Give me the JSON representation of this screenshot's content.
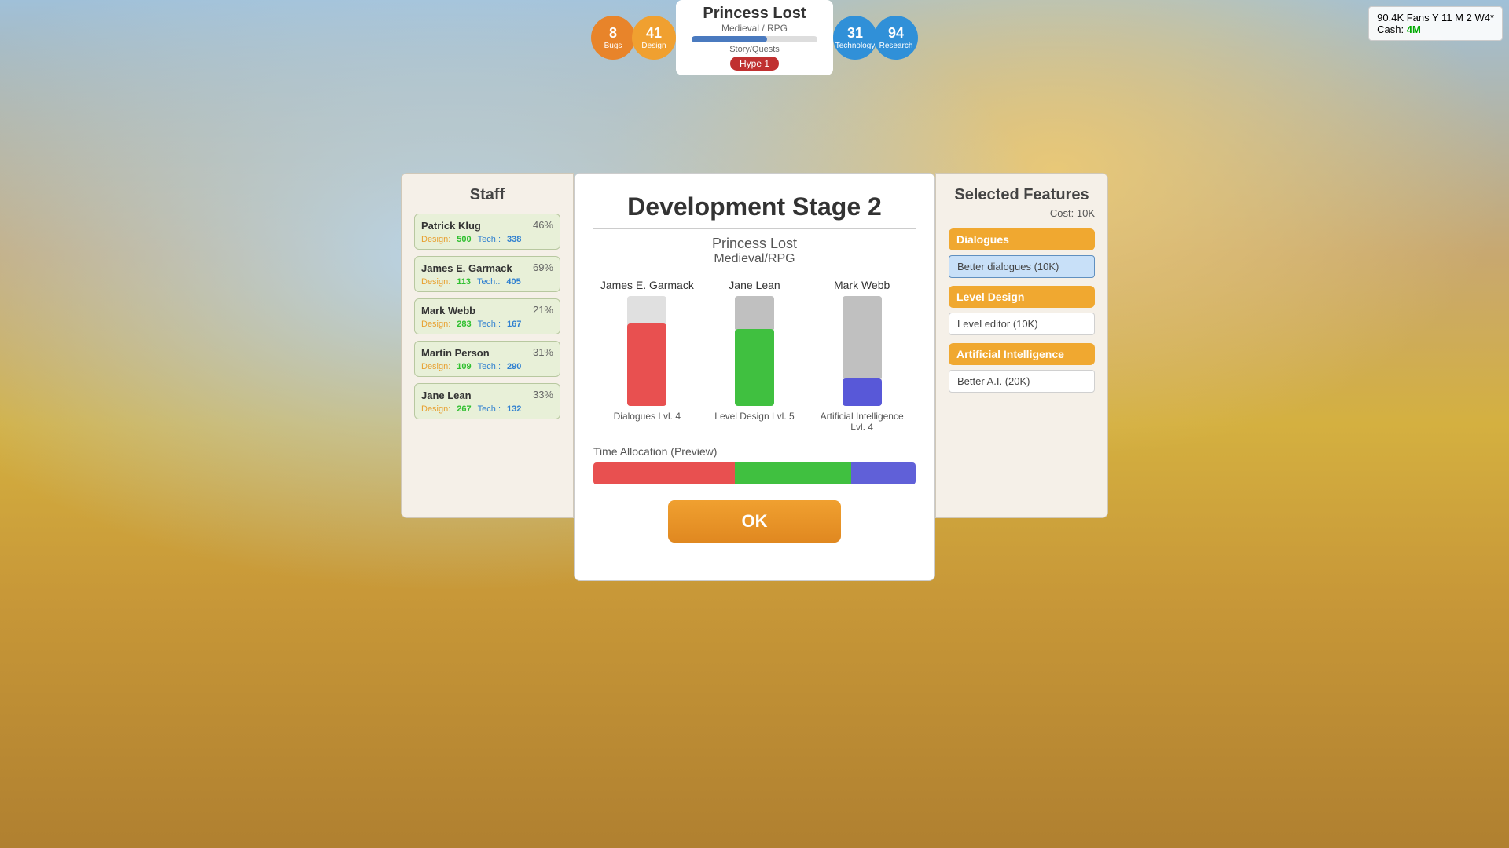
{
  "hud": {
    "bugs_count": "8",
    "bugs_label": "Bugs",
    "design_count": "41",
    "design_label": "Design",
    "game_title": "Princess Lost",
    "game_genre": "Medieval / RPG",
    "progress_label": "Story/Quests",
    "hype_label": "Hype 1",
    "technology_count": "31",
    "technology_label": "Technology",
    "research_count": "94",
    "research_label": "Research"
  },
  "top_right": {
    "fans": "90.4K Fans Y 11 M 2 W4*",
    "cash_label": "Cash:",
    "cash_value": "4M"
  },
  "staff_panel": {
    "title": "Staff",
    "members": [
      {
        "name": "Patrick Klug",
        "percent": "46%",
        "design_label": "Design:",
        "design_val": "500",
        "tech_label": "Tech.:",
        "tech_val": "338"
      },
      {
        "name": "James E. Garmack",
        "percent": "69%",
        "design_label": "Design:",
        "design_val": "113",
        "tech_label": "Tech.:",
        "tech_val": "405"
      },
      {
        "name": "Mark Webb",
        "percent": "21%",
        "design_label": "Design:",
        "design_val": "283",
        "tech_label": "Tech.:",
        "tech_val": "167"
      },
      {
        "name": "Martin Person",
        "percent": "31%",
        "design_label": "Design:",
        "design_val": "109",
        "tech_label": "Tech.:",
        "tech_val": "290"
      },
      {
        "name": "Jane Lean",
        "percent": "33%",
        "design_label": "Design:",
        "design_val": "267",
        "tech_label": "Tech.:",
        "tech_val": "132"
      }
    ]
  },
  "dev_dialog": {
    "title": "Development Stage 2",
    "game_name": "Princess Lost",
    "game_genre": "Medieval/RPG",
    "staff_cols": [
      {
        "name": "James E. Garmack",
        "task": "Dialogues Lvl. 4"
      },
      {
        "name": "Jane Lean",
        "task": "Level Design Lvl. 5"
      },
      {
        "name": "Mark Webb",
        "task": "Artificial Intelligence Lvl. 4"
      }
    ],
    "time_alloc_label": "Time Allocation (Preview)",
    "ok_label": "OK"
  },
  "features_panel": {
    "title": "Selected Features",
    "cost_label": "Cost: 10K",
    "categories": [
      {
        "name": "Dialogues",
        "items": [
          {
            "label": "Better dialogues (10K)",
            "selected": true
          }
        ]
      },
      {
        "name": "Level Design",
        "items": [
          {
            "label": "Level editor (10K)",
            "selected": false
          }
        ]
      },
      {
        "name": "Artificial Intelligence",
        "items": [
          {
            "label": "Better A.I. (20K)",
            "selected": false
          }
        ]
      }
    ]
  }
}
